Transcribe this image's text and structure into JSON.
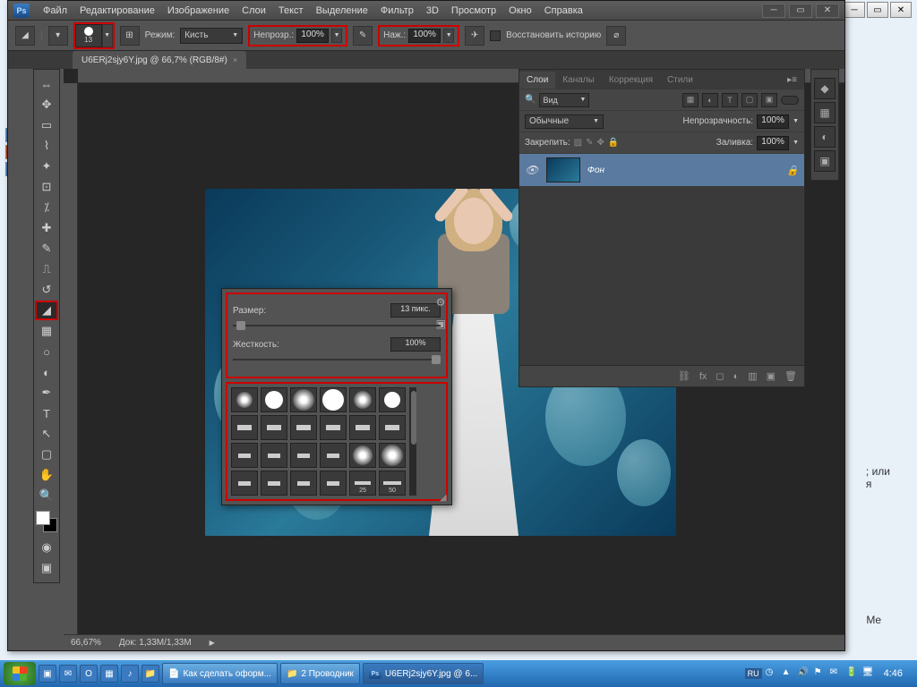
{
  "app": {
    "logo": "Ps"
  },
  "menu": [
    "Файл",
    "Редактирование",
    "Изображение",
    "Слои",
    "Текст",
    "Выделение",
    "Фильтр",
    "3D",
    "Просмотр",
    "Окно",
    "Справка"
  ],
  "options": {
    "brush_size": "13",
    "mode_label": "Режим:",
    "mode_value": "Кисть",
    "opacity_label": "Непрозр.:",
    "opacity_value": "100%",
    "flow_label": "Наж.:",
    "flow_value": "100%",
    "erase_history": "Восстановить историю"
  },
  "document": {
    "tab_title": "U6ERj2sjy6Y.jpg @ 66,7% (RGB/8#)",
    "zoom": "66,67%",
    "doc_size": "Док: 1,33M/1,33M"
  },
  "brush_popup": {
    "size_label": "Размер:",
    "size_value": "13 пикс.",
    "hardness_label": "Жесткость:",
    "hardness_value": "100%",
    "preset_labels": [
      "25",
      "50"
    ]
  },
  "layers_panel": {
    "tabs": [
      "Слои",
      "Каналы",
      "Коррекция",
      "Стили"
    ],
    "kind": "Вид",
    "blend_mode": "Обычные",
    "opacity_label": "Непрозрачность:",
    "opacity_value": "100%",
    "lock_label": "Закрепить:",
    "fill_label": "Заливка:",
    "fill_value": "100%",
    "layer_name": "Фон"
  },
  "taskbar": {
    "items": [
      "Как сделать оформ...",
      "2 Проводник",
      "U6ERj2sjy6Y.jpg @ 6..."
    ],
    "lang": "RU",
    "time": "4:46"
  },
  "bg_text": {
    "line1": "; или",
    "line2": "я",
    "me": "Me"
  }
}
